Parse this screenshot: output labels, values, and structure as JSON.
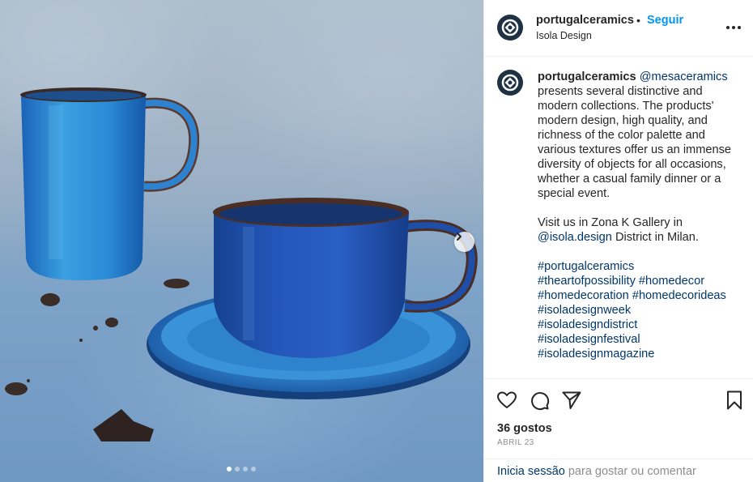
{
  "post": {
    "username": "portugalceramics",
    "separator": "•",
    "follow_label": "Seguir",
    "location": "Isola Design",
    "more_icon": "more-horizontal-icon"
  },
  "carousel": {
    "next_icon": "chevron-right-icon",
    "slide_count": 4,
    "active_slide": 1
  },
  "caption": {
    "username": "portugalceramics",
    "mention1": "@mesaceramics",
    "text1": " presents several distinctive and modern collections. The products' modern design, high quality, and richness of the color palette and various textures offer us an immense diversity of objects for all occasions, whether a casual family dinner or a special event.",
    "text2a": "Visit us in Zona K Gallery in ",
    "mention2": "@isola.design",
    "text2b": " District in Milan.",
    "hashtags": [
      "#portugalceramics",
      "#theartofpossibility #homedecor",
      "#homedecoration #homedecorideas",
      "#isoladesignweek",
      "#isoladesigndistrict",
      "#isoladesignfestival",
      "#isoladesignmagazine"
    ]
  },
  "actions": {
    "like_icon": "heart-icon",
    "comment_icon": "comment-icon",
    "share_icon": "send-icon",
    "save_icon": "bookmark-icon"
  },
  "stats": {
    "likes": "36 gostos",
    "date": "ABRIL 23"
  },
  "footer": {
    "login_label": "Inicia sessão",
    "rest": " para gostar ou comentar"
  },
  "colors": {
    "link": "#00376b",
    "follow": "#0095f6",
    "muted": "#8e8e8e",
    "ceramic_blue": "#1f6fc0"
  }
}
